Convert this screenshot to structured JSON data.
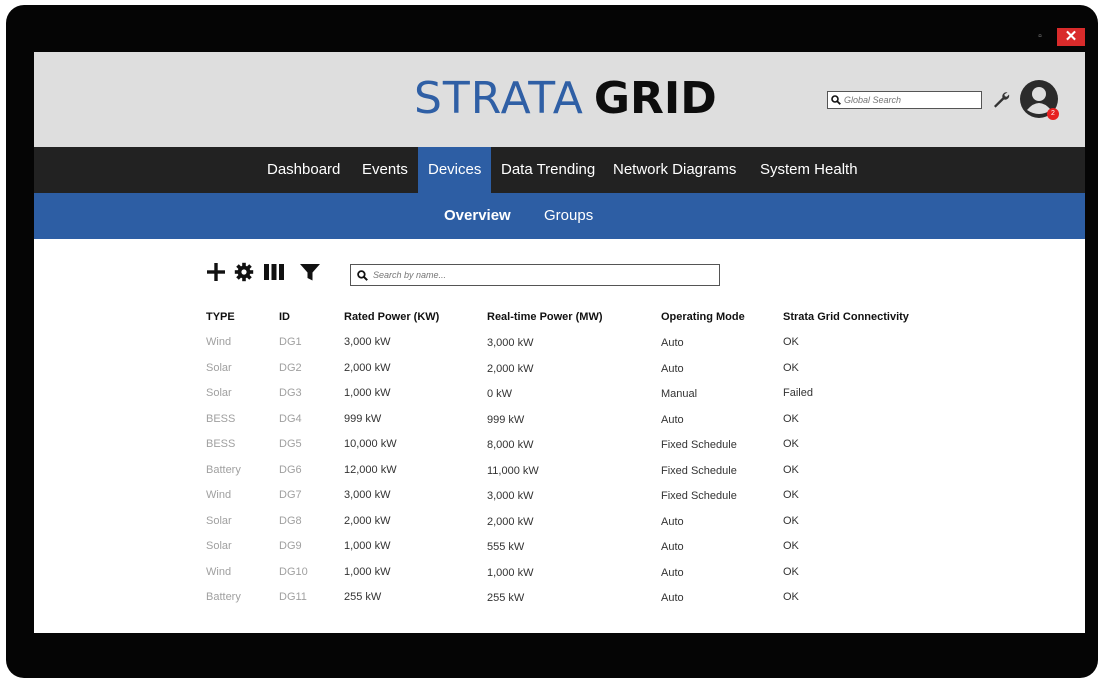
{
  "window": {
    "restore_glyph": "▫",
    "close_glyph": "✕"
  },
  "header": {
    "logo_part1": "STRATA",
    "logo_part2": "GRID",
    "global_search_placeholder": "Global Search",
    "notification_count": "2"
  },
  "nav": {
    "items": [
      {
        "label": "Dashboard"
      },
      {
        "label": "Events"
      },
      {
        "label": "Devices"
      },
      {
        "label": "Data Trending"
      },
      {
        "label": "Network Diagrams"
      },
      {
        "label": "System Health"
      }
    ],
    "active": "Devices"
  },
  "subnav": {
    "items": [
      {
        "label": "Overview"
      },
      {
        "label": "Groups"
      }
    ],
    "active": "Overview"
  },
  "toolbar": {
    "icons": [
      "plus-icon",
      "gear-icon",
      "columns-icon",
      "filter-icon"
    ],
    "search_placeholder": "Search by name..."
  },
  "table": {
    "columns": [
      "TYPE",
      "ID",
      "Rated Power (KW)",
      "Real-time Power (MW)",
      "Operating Mode",
      "Strata Grid Connectivity"
    ],
    "rows": [
      [
        "Wind",
        "DG1",
        "3,000 kW",
        "3,000 kW",
        "Auto",
        "OK"
      ],
      [
        "Solar",
        "DG2",
        "2,000 kW",
        "2,000 kW",
        "Auto",
        "OK"
      ],
      [
        "Solar",
        "DG3",
        "1,000 kW",
        "0 kW",
        "Manual",
        "Failed"
      ],
      [
        "BESS",
        "DG4",
        "999 kW",
        "999 kW",
        "Auto",
        "OK"
      ],
      [
        "BESS",
        "DG5",
        "10,000 kW",
        "8,000 kW",
        "Fixed Schedule",
        "OK"
      ],
      [
        "Battery",
        "DG6",
        "12,000 kW",
        "11,000 kW",
        "Fixed Schedule",
        "OK"
      ],
      [
        "Wind",
        "DG7",
        "3,000 kW",
        "3,000 kW",
        "Fixed Schedule",
        "OK"
      ],
      [
        "Solar",
        "DG8",
        "2,000 kW",
        "2,000 kW",
        "Auto",
        "OK"
      ],
      [
        "Solar",
        "DG9",
        "1,000 kW",
        "555 kW",
        "Auto",
        "OK"
      ],
      [
        "Wind",
        "DG10",
        "1,000 kW",
        "1,000 kW",
        "Auto",
        "OK"
      ],
      [
        "Battery",
        "DG11",
        "255 kW",
        "255 kW",
        "Auto",
        "OK"
      ]
    ]
  },
  "colors": {
    "brand_blue": "#2d5ea4",
    "nav_bg": "#222222",
    "header_bg": "#dedede",
    "close_red": "#d92b2b"
  }
}
